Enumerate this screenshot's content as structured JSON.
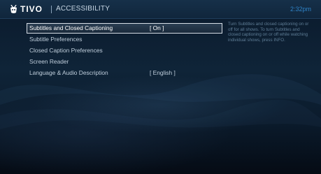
{
  "header": {
    "logo_text": "TIVO",
    "title": "ACCESSIBILITY",
    "clock": "2:32pm"
  },
  "menu": {
    "items": [
      {
        "label": "Subtitles and Closed Captioning",
        "value": "[ On ]",
        "selected": true
      },
      {
        "label": "Subtitle Preferences",
        "value": ""
      },
      {
        "label": "Closed Caption Preferences",
        "value": ""
      },
      {
        "label": "Screen Reader",
        "value": ""
      },
      {
        "label": "Language & Audio Description",
        "value": "[ English ]"
      }
    ]
  },
  "help_text": "Turn Subtitles and closed captioning on or off for all shows. To turn Subtitles and closed captioning on or off while watching individual shows, press INFO.",
  "colors": {
    "accent": "#2f83c7",
    "background": "#0f2438",
    "selection_border": "#d6dde5"
  },
  "icons": {
    "logo": "tivo-robot-icon"
  }
}
